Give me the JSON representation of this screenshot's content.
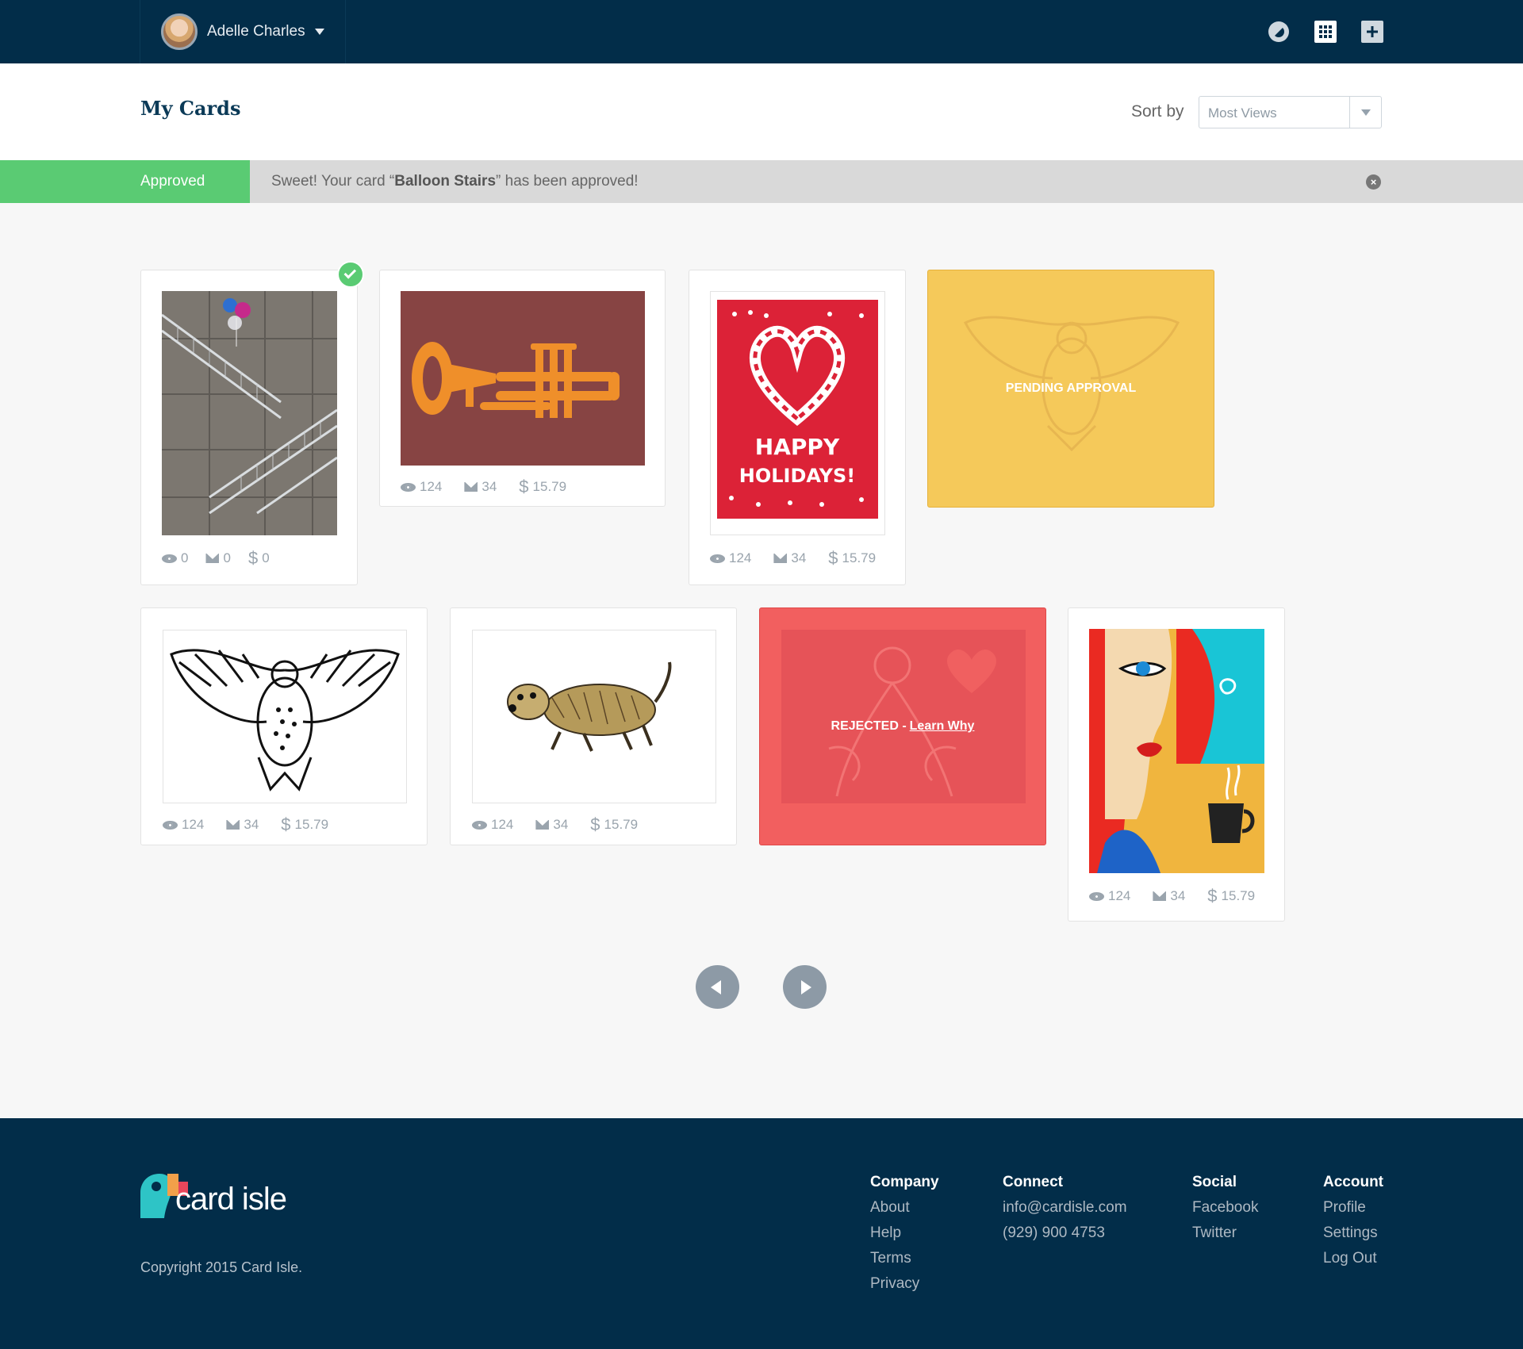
{
  "topbar": {
    "user_name": "Adelle Charles",
    "icons": [
      "dashboard-icon",
      "grid-icon",
      "plus-icon"
    ]
  },
  "header": {
    "title": "My Cards",
    "sort_label": "Sort by",
    "sort_value": "Most Views"
  },
  "alert": {
    "tag": "Approved",
    "message_prefix": "Sweet! Your card “",
    "card_name": "Balloon Stairs",
    "message_suffix": "” has been approved!",
    "close": "×"
  },
  "cards": [
    {
      "views": "0",
      "sends": "0",
      "earnings": "0",
      "status": "approved"
    },
    {
      "views": "124",
      "sends": "34",
      "earnings": "15.79"
    },
    {
      "views": "124",
      "sends": "34",
      "earnings": "15.79"
    },
    {
      "status_text": "PENDING APPROVAL"
    },
    {
      "views": "124",
      "sends": "34",
      "earnings": "15.79"
    },
    {
      "views": "124",
      "sends": "34",
      "earnings": "15.79"
    },
    {
      "status_text": "REJECTED - ",
      "status_link": "Learn Why"
    },
    {
      "views": "124",
      "sends": "34",
      "earnings": "15.79"
    }
  ],
  "holidays_art": {
    "line1": "HAPPY",
    "line2": "HOLIDAYS!"
  },
  "colors": {
    "navy": "#022d49",
    "approved": "#5acb73",
    "pending": "#f5c95a",
    "rejected": "#f25f5f"
  },
  "footer": {
    "logo_text": "card isle",
    "copyright": "Copyright 2015 Card Isle.",
    "columns": [
      {
        "title": "Company",
        "links": [
          "About",
          "Help",
          "Terms",
          "Privacy"
        ]
      },
      {
        "title": "Connect",
        "links": [
          "info@cardisle.com",
          "(929) 900 4753"
        ]
      },
      {
        "title": "Social",
        "links": [
          "Facebook",
          "Twitter"
        ]
      },
      {
        "title": "Account",
        "links": [
          "Profile",
          "Settings",
          "Log Out"
        ]
      }
    ]
  }
}
